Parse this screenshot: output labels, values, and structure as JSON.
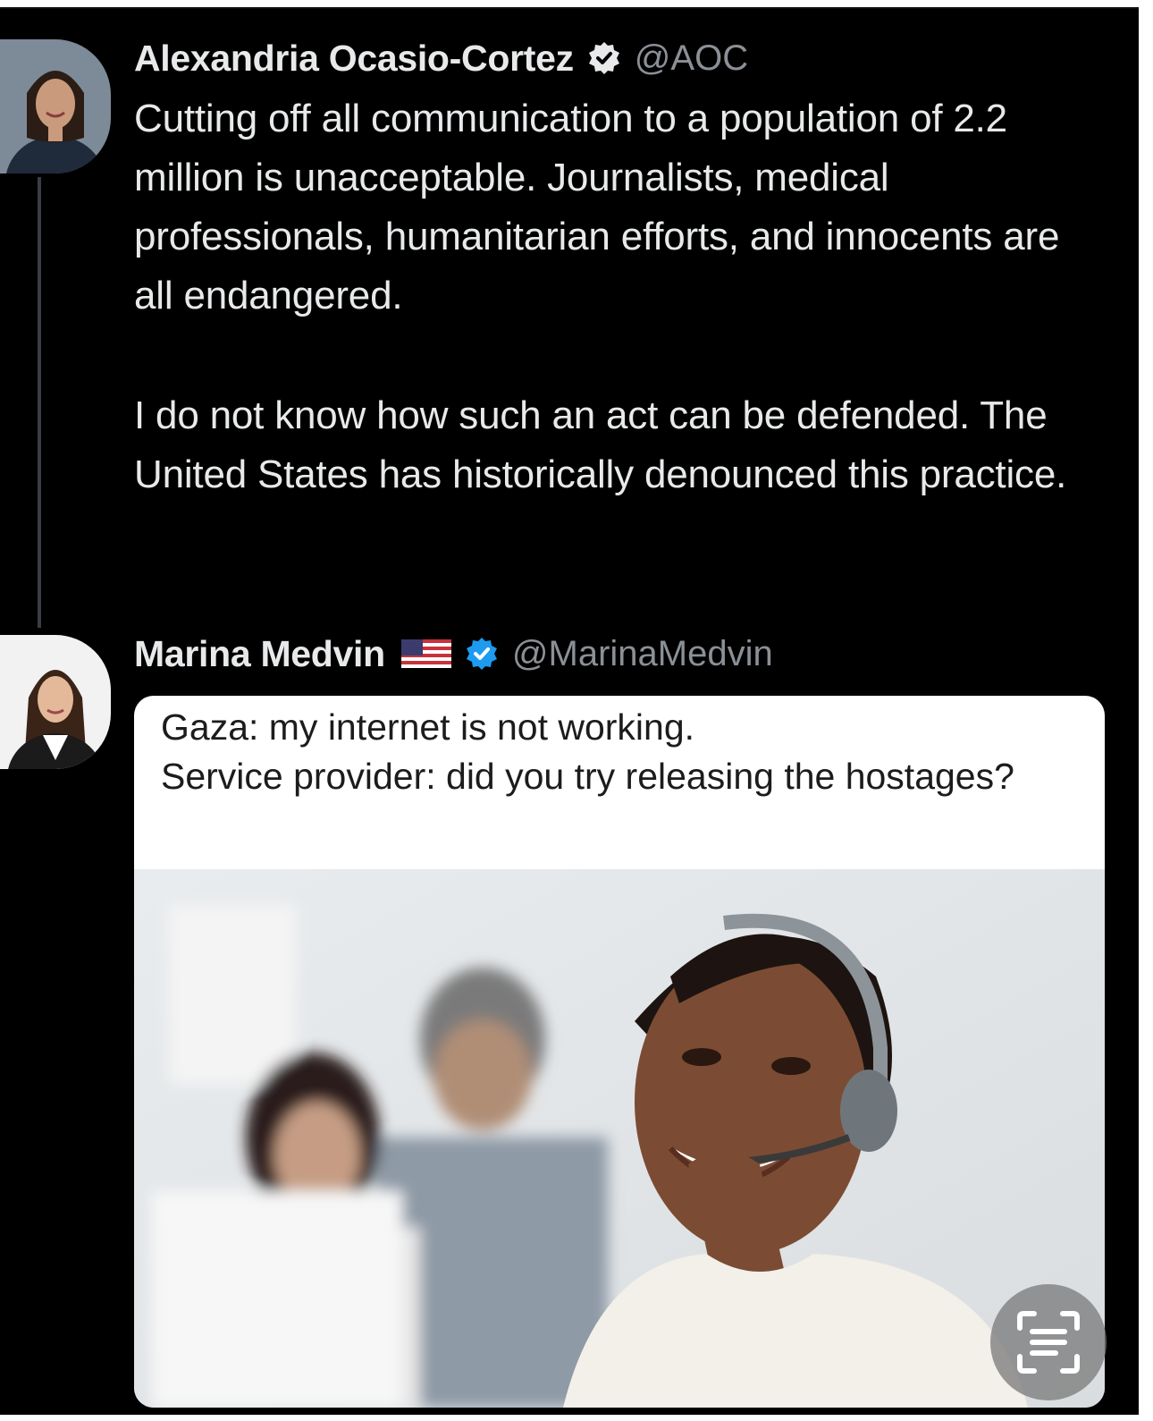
{
  "tweets": [
    {
      "author_name": "Alexandria Ocasio-Cortez",
      "handle": "@AOC",
      "verified": true,
      "paragraphs": [
        "Cutting off all communication to a population of 2.2 million is unacceptable. Journalists, medical professionals, humanitarian efforts, and innocents are all endangered.",
        "I do not know how such an act can be defended. The United States has historically denounced this practice."
      ]
    },
    {
      "author_name": "Marina Medvin",
      "handle": "@MarinaMedvin",
      "verified": true,
      "flag_icon": "us-flag-icon",
      "card": {
        "caption_lines": [
          "Gaza: my internet is not working.",
          "Service provider: did you try releasing the hostages?"
        ]
      }
    }
  ],
  "colors": {
    "background": "#000000",
    "text": "#e7e9ea",
    "secondary_text": "#8b9096",
    "verified_badge": "#1d9bf0",
    "thread_line": "#3a3d42"
  },
  "icons": {
    "scan_button": "live-text-scan-icon"
  }
}
